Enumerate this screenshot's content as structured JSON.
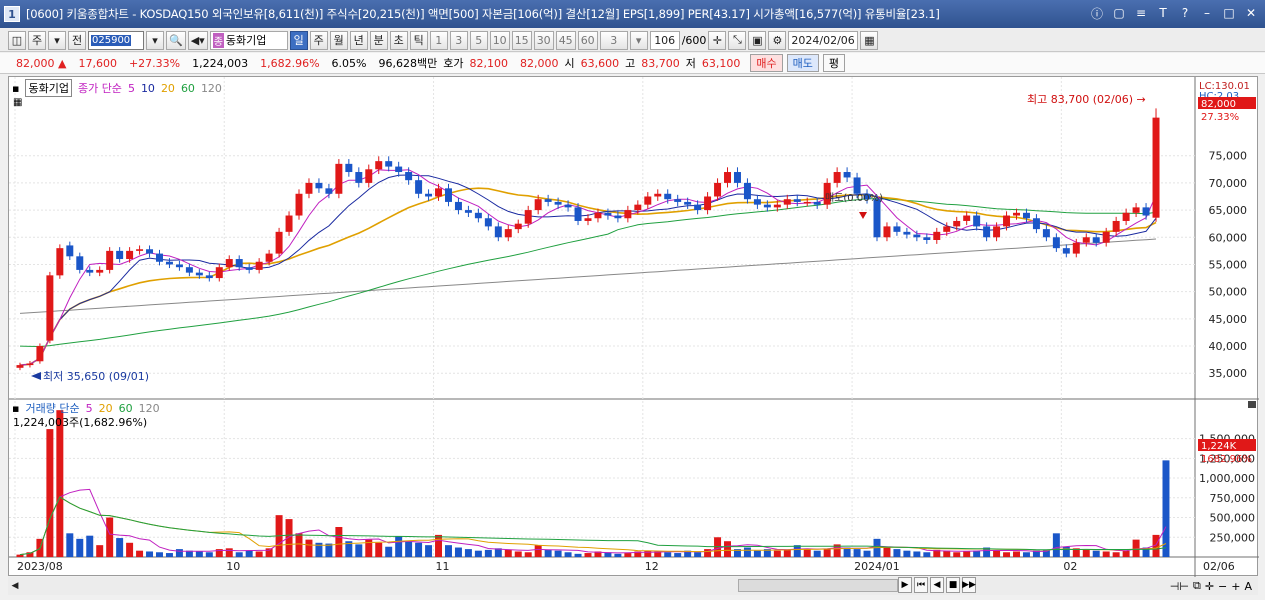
{
  "window": {
    "title": "[0600] 키움종합차트 - KOSDAQ150 외국인보유[8,611(천)] 주식수[20,215(천)] 액면[500] 자본금[106(억)] 결산[12월] EPS[1,899] PER[43.17] 시가총액[16,577(억)] 유통비율[23.1]",
    "app_icon": "1",
    "controls": [
      "ⓘ",
      "▢",
      "≡",
      "T",
      "?",
      "–",
      "□",
      "✕"
    ]
  },
  "toolbar": {
    "period_type": "주",
    "mode": "전",
    "code": "025900",
    "name_icon": "종",
    "name": "동화기업",
    "intervals": [
      "일",
      "주",
      "월",
      "년",
      "분",
      "초",
      "틱"
    ],
    "selected_interval": "일",
    "minutes": [
      "1",
      "3",
      "5",
      "10",
      "15",
      "30",
      "45",
      "60"
    ],
    "minute_select": "3",
    "count": "106",
    "count_total": "/600",
    "date": "2024/02/06"
  },
  "infobar": {
    "price": "82,000 ▲",
    "change": "17,600",
    "change_pct": "+27.33%",
    "volume": "1,224,003",
    "volume_pct": "1,682.96%",
    "turnover": "6.05%",
    "amount": "96,628백만",
    "quote_label": "호가",
    "quote_ask": "82,100",
    "quote_bid": "82,000",
    "open_label": "시",
    "open": "63,600",
    "high_label": "고",
    "high": "83,700",
    "low_label": "저",
    "low": "63,100",
    "buy_label": "매수",
    "sell_label": "매도",
    "eval_label": "평"
  },
  "price_legend": {
    "name": "동화기업",
    "label": "종가 단순",
    "ma": [
      "5",
      "10",
      "20",
      "60",
      "120"
    ]
  },
  "volume_legend": {
    "label": "거래량 단순",
    "ma": [
      "5",
      "20",
      "60",
      "120"
    ],
    "value": "1,224,003주(1,682.96%)"
  },
  "colors": {
    "up": "#e01818",
    "down": "#1a56c8",
    "ma5": "#c020c0",
    "ma10": "#1a2aa0",
    "ma20": "#e0a000",
    "ma60": "#20a040",
    "ma120": "#888888"
  },
  "annotations": {
    "high": "최고 83,700 (02/06)",
    "low": "최저 35,650 (09/01)",
    "mark": "매도(0.00%)",
    "lc": "LC:130.01",
    "hc": "HC:2.03",
    "price_tag": "82,000",
    "pct_tag": "27.33%",
    "vol_tag": "1,224K",
    "vol_pct_tag": "1682.96%"
  },
  "chart_data": {
    "type": "candlestick",
    "price_axis": {
      "ylim": [
        31000,
        88000
      ],
      "ticks": [
        "75,000",
        "70,000",
        "65,000",
        "60,000",
        "55,000",
        "50,000",
        "45,000",
        "40,000",
        "35,000"
      ]
    },
    "volume_axis": {
      "ylim": [
        0,
        1900000
      ],
      "ticks": [
        "1,500,000",
        "1,250,000",
        "1,000,000",
        "750,000",
        "500,000",
        "250,000"
      ]
    },
    "date_labels": [
      "2023/08",
      "10",
      "11",
      "12",
      "2024/01",
      "02",
      "02/06"
    ],
    "closes": [
      36500,
      36800,
      40000,
      53000,
      58000,
      56500,
      54000,
      53500,
      54000,
      57500,
      56000,
      57500,
      57800,
      57000,
      55500,
      55000,
      54500,
      53500,
      53000,
      52500,
      54500,
      56000,
      54500,
      54000,
      55500,
      57000,
      61000,
      64000,
      68000,
      70000,
      69000,
      68000,
      73500,
      72000,
      70000,
      72500,
      74000,
      73000,
      72000,
      70500,
      68000,
      67500,
      69000,
      66500,
      65000,
      64500,
      63500,
      62000,
      60000,
      61500,
      62500,
      65000,
      67000,
      66500,
      66000,
      65500,
      63000,
      63500,
      64500,
      64000,
      63500,
      65000,
      66000,
      67500,
      68000,
      67000,
      66500,
      66000,
      65000,
      67500,
      70000,
      72000,
      70000,
      67000,
      66000,
      65500,
      66000,
      67000,
      66500,
      66500,
      66000,
      70000,
      72000,
      71000,
      68000,
      67000,
      60000,
      62000,
      61000,
      60500,
      60000,
      59500,
      61000,
      62000,
      63000,
      64000,
      62000,
      60000,
      62000,
      64000,
      64500,
      63500,
      61500,
      60000,
      58000,
      57000,
      59000,
      60000,
      59000,
      61000,
      63000,
      64500,
      65500,
      64000,
      82000
    ],
    "opens": [
      36000,
      36500,
      37200,
      41000,
      53000,
      58500,
      56500,
      54000,
      53500,
      54000,
      57500,
      56000,
      57500,
      57800,
      57000,
      55500,
      55000,
      54500,
      53500,
      53000,
      52500,
      54500,
      56000,
      54500,
      54000,
      55500,
      57000,
      61000,
      64000,
      68000,
      70000,
      69000,
      68000,
      73500,
      72000,
      70000,
      72500,
      74000,
      73000,
      72000,
      70500,
      68000,
      67500,
      69000,
      66500,
      65000,
      64500,
      63500,
      62000,
      60000,
      61500,
      62500,
      65000,
      67000,
      66500,
      66000,
      65500,
      63000,
      63500,
      64500,
      64000,
      63500,
      65000,
      66000,
      67500,
      68000,
      67000,
      66500,
      66000,
      65000,
      67500,
      70000,
      72000,
      70000,
      67000,
      66000,
      65500,
      66000,
      67000,
      66500,
      66500,
      66000,
      70000,
      72000,
      71000,
      68000,
      67000,
      60000,
      62000,
      61000,
      60500,
      60000,
      59500,
      61000,
      62000,
      63000,
      64000,
      62000,
      60000,
      62000,
      64000,
      64500,
      63500,
      61500,
      60000,
      58000,
      57000,
      59000,
      60000,
      59000,
      61000,
      63000,
      64500,
      65500,
      63600
    ],
    "volumes": [
      30000,
      60000,
      230000,
      1620000,
      1860000,
      300000,
      230000,
      270000,
      150000,
      500000,
      240000,
      180000,
      80000,
      70000,
      60000,
      50000,
      100000,
      80000,
      70000,
      60000,
      100000,
      110000,
      60000,
      80000,
      70000,
      110000,
      530000,
      480000,
      300000,
      220000,
      180000,
      170000,
      380000,
      200000,
      160000,
      220000,
      180000,
      130000,
      260000,
      200000,
      180000,
      150000,
      280000,
      150000,
      120000,
      100000,
      80000,
      90000,
      110000,
      90000,
      70000,
      60000,
      150000,
      90000,
      80000,
      60000,
      40000,
      50000,
      70000,
      60000,
      40000,
      50000,
      70000,
      80000,
      70000,
      60000,
      50000,
      80000,
      60000,
      100000,
      250000,
      200000,
      100000,
      120000,
      80000,
      100000,
      80000,
      90000,
      150000,
      100000,
      80000,
      100000,
      160000,
      120000,
      100000,
      80000,
      230000,
      120000,
      100000,
      80000,
      70000,
      60000,
      90000,
      80000,
      60000,
      70000,
      80000,
      120000,
      80000,
      60000,
      70000,
      60000,
      80000,
      90000,
      300000,
      130000,
      110000,
      100000,
      80000,
      70000,
      60000,
      80000,
      220000,
      120000,
      280000,
      1224003
    ]
  },
  "bottom": {
    "nav": [
      "▶",
      "⏮",
      "◀",
      "■",
      "▶▶"
    ],
    "zoom": [
      "−",
      "+",
      "A"
    ]
  }
}
